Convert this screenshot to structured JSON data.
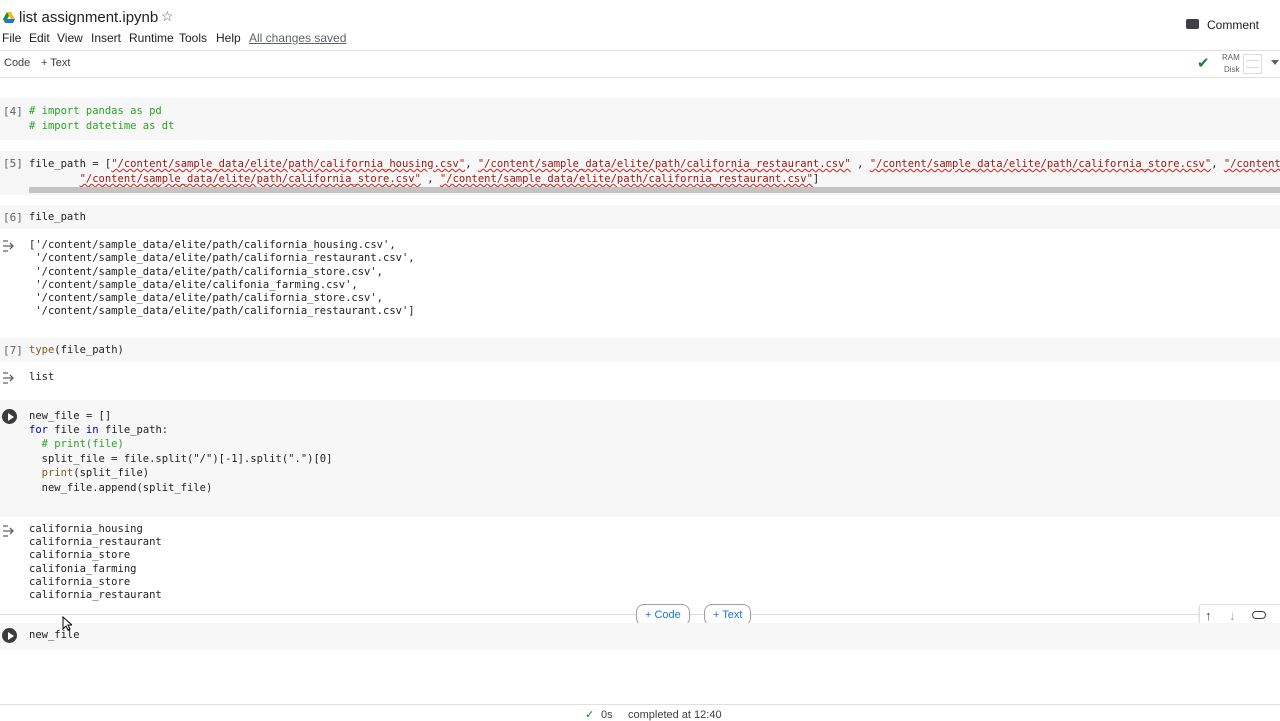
{
  "header": {
    "title": "list assignment.ipynb",
    "comment_label": "Comment",
    "menu": [
      "File",
      "Edit",
      "View",
      "Insert",
      "Runtime",
      "Tools",
      "Help"
    ],
    "saved_status": "All changes saved"
  },
  "toolbar": {
    "code_label": "Code",
    "text_label": "+ Text",
    "ram_label": "RAM",
    "disk_label": "Disk"
  },
  "cells": {
    "c4": {
      "exec": "[4]",
      "lines": [
        "# import pandas as pd",
        "# import datetime as dt"
      ]
    },
    "c5": {
      "exec": "[5]",
      "prefix": "file_path = [",
      "s1": "\"/content/sample_data/elite/path/california_housing.csv\"",
      "s2": "\"/content/sample_data/elite/path/california_restaurant.csv\"",
      "s3": "\"/content/sample_data/elite/path/california_store.csv\"",
      "s4": "\"/content/sample_data/eli",
      "s5": "\"/content/sample_data/elite/path/california_store.csv\"",
      "s6": "\"/content/sample_data/elite/path/california_restaurant.csv\"",
      "close": "]"
    },
    "c6": {
      "exec": "[6]",
      "code": "file_path",
      "output": [
        "['/content/sample_data/elite/path/california_housing.csv',",
        " '/content/sample_data/elite/path/california_restaurant.csv',",
        " '/content/sample_data/elite/path/california_store.csv',",
        " '/content/sample_data/elite/califonia_farming.csv',",
        " '/content/sample_data/elite/path/california_store.csv',",
        " '/content/sample_data/elite/path/california_restaurant.csv']"
      ]
    },
    "c7": {
      "exec": "[7]",
      "func": "type",
      "arg": "(file_path)",
      "output": "list"
    },
    "c8": {
      "l1": "new_file = []",
      "l2_kw": "for",
      "l2_a": " file ",
      "l2_in": "in",
      "l2_b": " file_path:",
      "l3": "  # print(file)",
      "l4": "  split_file = file.split(\"/\")[-1].split(\".\")[0]",
      "l5_fn": "  print",
      "l5_rest": "(split_file)",
      "l6": "  new_file.append(split_file)",
      "output": [
        "california_housing",
        "california_restaurant",
        "california_store",
        "califonia_farming",
        "california_store",
        "california_restaurant"
      ]
    },
    "c9": {
      "code": "new_file"
    }
  },
  "add_bar": {
    "code_label": "+ Code",
    "text_label": "+ Text"
  },
  "status_bar": {
    "check": "✓",
    "time": "0s",
    "completed": "completed at 12:40"
  },
  "colors": {
    "keyword": "#0000cc",
    "comment": "#28a428",
    "string": "#a31515",
    "accent": "#1a73e8",
    "check_green": "#188038"
  }
}
